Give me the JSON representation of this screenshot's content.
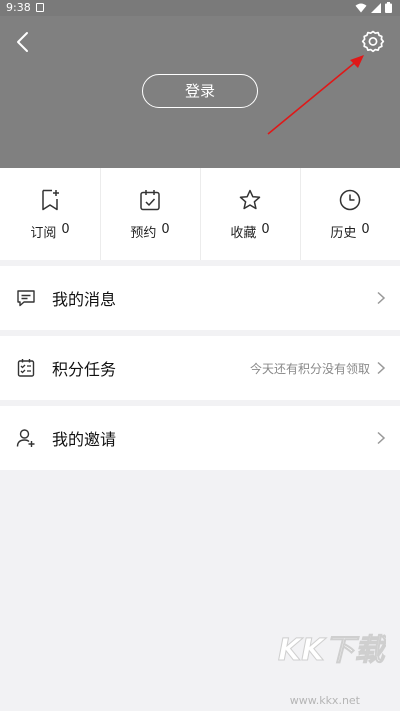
{
  "status_bar": {
    "time": "9:38",
    "icons": [
      "sd-card-icon",
      "wifi-icon",
      "signal-icon",
      "battery-icon"
    ]
  },
  "header": {
    "login_label": "登录",
    "background": "#808080",
    "annotation_color": "#e01818"
  },
  "stats": [
    {
      "label": "订阅",
      "count": "0",
      "icon": "bookmark-add-icon"
    },
    {
      "label": "预约",
      "count": "0",
      "icon": "calendar-check-icon"
    },
    {
      "label": "收藏",
      "count": "0",
      "icon": "star-icon"
    },
    {
      "label": "历史",
      "count": "0",
      "icon": "clock-icon"
    }
  ],
  "menu": [
    {
      "title": "我的消息",
      "hint": "",
      "icon": "message-icon"
    },
    {
      "title": "积分任务",
      "hint": "今天还有积分没有领取",
      "icon": "task-list-icon"
    },
    {
      "title": "我的邀请",
      "hint": "",
      "icon": "add-user-icon"
    }
  ],
  "watermark": {
    "logo_text": "KK下载",
    "url": "www.kkx.net"
  }
}
